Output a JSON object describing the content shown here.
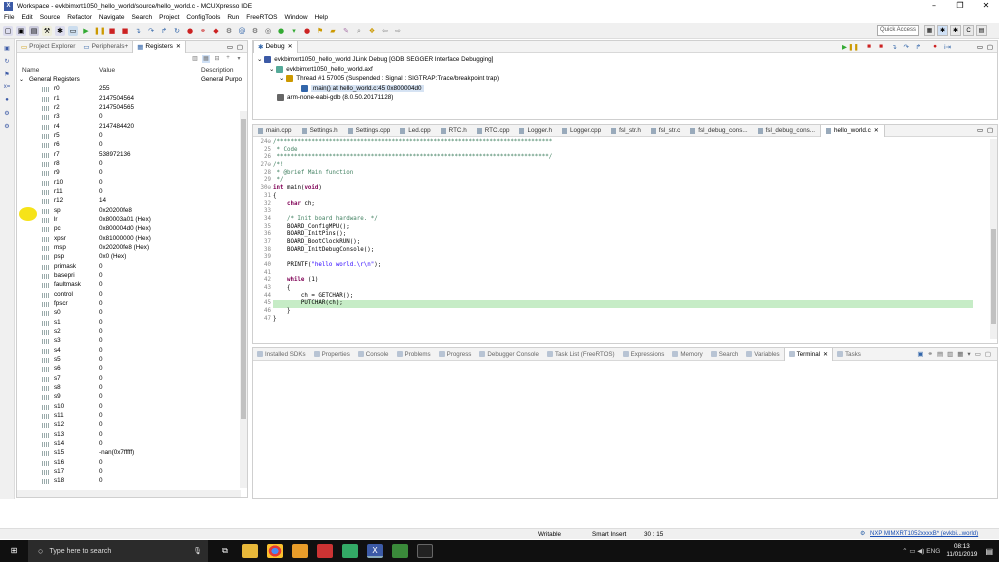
{
  "window": {
    "title": "Workspace - evkbimxrt1050_hello_world/source/hello_world.c - MCUXpresso IDE",
    "minimize": "–",
    "maximize": "❐",
    "close": "✕"
  },
  "menu": [
    "File",
    "Edit",
    "Source",
    "Refactor",
    "Navigate",
    "Search",
    "Project",
    "ConfigTools",
    "Run",
    "FreeRTOS",
    "Window",
    "Help"
  ],
  "toolbar": {
    "quick_access_placeholder": "Quick Access"
  },
  "left_panel": {
    "tabs": [
      "Project Explorer",
      "Peripherals+",
      "Registers"
    ],
    "active_tab": "Registers",
    "columns": {
      "name": "Name",
      "value": "Value",
      "description": "Description"
    },
    "group": {
      "name": "General Registers",
      "description": "General Purpo"
    },
    "registers": [
      {
        "name": "r0",
        "value": "255"
      },
      {
        "name": "r1",
        "value": "2147504564"
      },
      {
        "name": "r2",
        "value": "2147504565"
      },
      {
        "name": "r3",
        "value": "0"
      },
      {
        "name": "r4",
        "value": "2147484420"
      },
      {
        "name": "r5",
        "value": "0"
      },
      {
        "name": "r6",
        "value": "0"
      },
      {
        "name": "r7",
        "value": "538972136"
      },
      {
        "name": "r8",
        "value": "0"
      },
      {
        "name": "r9",
        "value": "0"
      },
      {
        "name": "r10",
        "value": "0"
      },
      {
        "name": "r11",
        "value": "0"
      },
      {
        "name": "r12",
        "value": "14"
      },
      {
        "name": "sp",
        "value": "0x20200fe8"
      },
      {
        "name": "lr",
        "value": "0x80003a01 (Hex)"
      },
      {
        "name": "pc",
        "value": "0x800004d0 (Hex)"
      },
      {
        "name": "xpsr",
        "value": "0x81000000 (Hex)"
      },
      {
        "name": "msp",
        "value": "0x20200fe8 (Hex)"
      },
      {
        "name": "psp",
        "value": "0x0 (Hex)"
      },
      {
        "name": "primask",
        "value": "0"
      },
      {
        "name": "basepri",
        "value": "0"
      },
      {
        "name": "faultmask",
        "value": "0"
      },
      {
        "name": "control",
        "value": "0"
      },
      {
        "name": "fpscr",
        "value": "0"
      },
      {
        "name": "s0",
        "value": "0"
      },
      {
        "name": "s1",
        "value": "0"
      },
      {
        "name": "s2",
        "value": "0"
      },
      {
        "name": "s3",
        "value": "0"
      },
      {
        "name": "s4",
        "value": "0"
      },
      {
        "name": "s5",
        "value": "0"
      },
      {
        "name": "s6",
        "value": "0"
      },
      {
        "name": "s7",
        "value": "0"
      },
      {
        "name": "s8",
        "value": "0"
      },
      {
        "name": "s9",
        "value": "0"
      },
      {
        "name": "s10",
        "value": "0"
      },
      {
        "name": "s11",
        "value": "0"
      },
      {
        "name": "s12",
        "value": "0"
      },
      {
        "name": "s13",
        "value": "0"
      },
      {
        "name": "s14",
        "value": "0"
      },
      {
        "name": "s15",
        "value": "-nan(0x7fffff)"
      },
      {
        "name": "s16",
        "value": "0"
      },
      {
        "name": "s17",
        "value": "0"
      },
      {
        "name": "s18",
        "value": "0"
      }
    ]
  },
  "debug_panel": {
    "tab": "Debug",
    "tree": [
      "evkbimxrt1050_hello_world JLink Debug [GDB SEGGER Interface Debugging]",
      "evkbimxrt1050_hello_world.axf",
      "Thread #1 57005 (Suspended : Signal : SIGTRAP:Trace/breakpoint trap)",
      "main() at hello_world.c:45 0x800004d0",
      "arm-none-eabi-gdb (8.0.50.20171128)"
    ]
  },
  "editor": {
    "tabs": [
      "main.cpp",
      "Settings.h",
      "Settings.cpp",
      "Led.cpp",
      "RTC.h",
      "RTC.cpp",
      "Logger.h",
      "Logger.cpp",
      "fsl_str.h",
      "fsl_str.c",
      "fsl_debug_cons...",
      "fsl_debug_cons...",
      "hello_world.c"
    ],
    "active_tab": "hello_world.c",
    "lines": [
      {
        "n": "24⊖",
        "t": "/*******************************************************************************",
        "c": "cmt"
      },
      {
        "n": "25",
        "t": " * Code",
        "c": "cmt"
      },
      {
        "n": "26",
        "t": " ******************************************************************************/",
        "c": "cmt"
      },
      {
        "n": "27⊖",
        "t": "/*!",
        "c": "cmt"
      },
      {
        "n": "28",
        "t": " * @brief Main function",
        "c": "cmt"
      },
      {
        "n": "29",
        "t": " */",
        "c": "cmt"
      },
      {
        "n": "30⊖",
        "t": "int main(void)",
        "c": "kw"
      },
      {
        "n": "31",
        "t": "{",
        "c": ""
      },
      {
        "n": "32",
        "t": "    char ch;",
        "c": "kw"
      },
      {
        "n": "33",
        "t": "",
        "c": ""
      },
      {
        "n": "34",
        "t": "    /* Init board hardware. */",
        "c": "cmt"
      },
      {
        "n": "35",
        "t": "    BOARD_ConfigMPU();",
        "c": ""
      },
      {
        "n": "36",
        "t": "    BOARD_InitPins();",
        "c": ""
      },
      {
        "n": "37",
        "t": "    BOARD_BootClockRUN();",
        "c": ""
      },
      {
        "n": "38",
        "t": "    BOARD_InitDebugConsole();",
        "c": ""
      },
      {
        "n": "39",
        "t": "",
        "c": ""
      },
      {
        "n": "40",
        "t": "    PRINTF(\"hello world.\\r\\n\");",
        "c": "str"
      },
      {
        "n": "41",
        "t": "",
        "c": ""
      },
      {
        "n": "42",
        "t": "    while (1)",
        "c": "kw"
      },
      {
        "n": "43",
        "t": "    {",
        "c": ""
      },
      {
        "n": "44",
        "t": "        ch = GETCHAR();",
        "c": ""
      },
      {
        "n": "45",
        "t": "        PUTCHAR(ch);",
        "c": "cur"
      },
      {
        "n": "46",
        "t": "    }",
        "c": ""
      },
      {
        "n": "47",
        "t": "}",
        "c": ""
      }
    ]
  },
  "bottom_panel": {
    "tabs": [
      "Installed SDKs",
      "Properties",
      "Console",
      "Problems",
      "Progress",
      "Debugger Console",
      "Task List (FreeRTOS)",
      "Expressions",
      "Memory",
      "Search",
      "Variables",
      "Terminal",
      "Tasks"
    ],
    "active_tab": "Terminal"
  },
  "status": {
    "mode": "Writable",
    "insert": "Smart Insert",
    "position": "30 : 15",
    "target": "NXP MIMXRT1052xxxxB* (evkbi...world)"
  },
  "taskbar": {
    "search_placeholder": "Type here to search",
    "time": "08:13",
    "date": "11/01/2019"
  }
}
